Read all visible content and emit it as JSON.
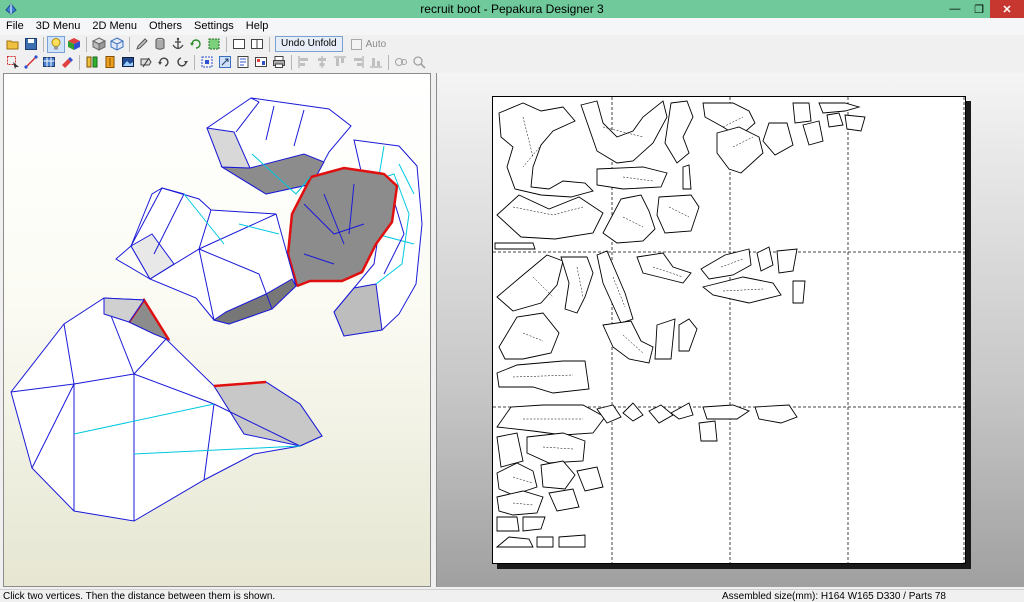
{
  "window": {
    "title": "recruit boot - Pepakura Designer 3",
    "controls": {
      "minimize": "—",
      "maximize": "❐",
      "close": "✕"
    }
  },
  "menu": {
    "items": [
      "File",
      "3D Menu",
      "2D Menu",
      "Others",
      "Settings",
      "Help"
    ]
  },
  "toolbar": {
    "row1_icons": [
      "open-icon",
      "save-icon",
      "light-bulb-icon",
      "color-cube-icon",
      "texture-cube-icon",
      "wireframe-cube-icon",
      "pencil-icon",
      "cylinder-icon",
      "anchor-icon",
      "rotate-view-icon",
      "select-faces-icon",
      "single-view-icon",
      "split-view-icon"
    ],
    "undo_unfold_label": "Undo Unfold",
    "auto_label": "Auto",
    "row2_icons": [
      "select-tool-icon",
      "move-vertex-icon",
      "grid-icon",
      "paint-icon",
      "join-edge-icon",
      "flap-icon",
      "image-icon",
      "edit-flap-icon",
      "rotate-part-icon",
      "snap-icon",
      "scale-icon",
      "page-setup-icon",
      "print-icon",
      "align-left-icon",
      "align-center-icon",
      "align-right-icon",
      "distribute-icon",
      "measure-icon",
      "zoom-icon"
    ]
  },
  "status": {
    "hint": "Click two vertices. Then the distance between them is shown.",
    "assembled": "Assembled size(mm): H164 W165 D330 / Parts 78"
  },
  "colors": {
    "titlebar": "#6fc99a",
    "close": "#c7372f",
    "model_edge": "#1a1ad8",
    "mountain_edge": "#00c8e0",
    "open_edge": "#e01010"
  }
}
